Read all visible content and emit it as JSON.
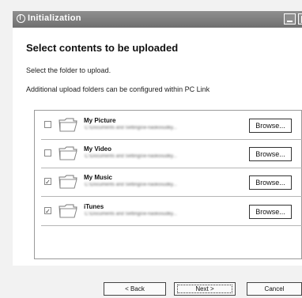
{
  "window": {
    "title": "Initialization"
  },
  "page": {
    "heading": "Select contents to be uploaded",
    "instruction": "Select the folder to upload.",
    "note": "Additional upload folders can be configured within PC Link"
  },
  "folders": [
    {
      "name": "My Picture",
      "path": "C:\\Documents and Settings\\e-naokosudky...",
      "checked": false,
      "browse_label": "Browse..."
    },
    {
      "name": "My Video",
      "path": "C:\\Documents and Settings\\e-naokosudky...",
      "checked": false,
      "browse_label": "Browse..."
    },
    {
      "name": "My Music",
      "path": "C:\\Documents and Settings\\e-naokosudky...",
      "checked": true,
      "browse_label": "Browse..."
    },
    {
      "name": "iTunes",
      "path": "C:\\Documents and Settings\\e-naokosudky...",
      "checked": true,
      "browse_label": "Browse..."
    }
  ],
  "buttons": {
    "back": "< Back",
    "next": "Next >",
    "cancel": "Cancel"
  },
  "icons": {
    "window": "app-icon",
    "folder": "folder-icon",
    "minimize": "minimize-icon",
    "maximize": "maximize-icon"
  },
  "colors": {
    "titlebar": "#7d7d7d",
    "panel": "#ffffff",
    "background": "#f2f2f2"
  }
}
